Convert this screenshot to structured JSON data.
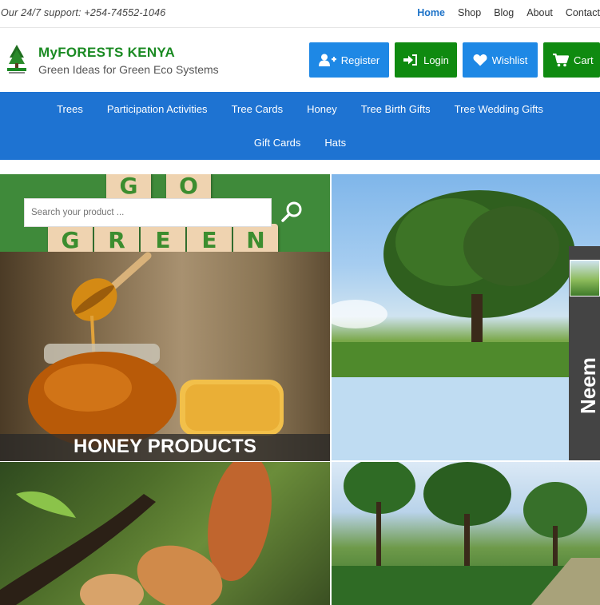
{
  "topbar": {
    "support": "Our 24/7 support: +254-74552-1046",
    "links": [
      {
        "label": "Home",
        "active": true
      },
      {
        "label": "Shop"
      },
      {
        "label": "Blog"
      },
      {
        "label": "About"
      },
      {
        "label": "Contact"
      }
    ]
  },
  "header": {
    "brand": "MyFORESTS KENYA",
    "tagline": "Green Ideas for Green Eco Systems",
    "buttons": {
      "register": "Register",
      "login": "Login",
      "wishlist": "Wishlist",
      "cart": "Cart"
    }
  },
  "nav": {
    "row1": [
      "Trees",
      "Participation Activities",
      "Tree Cards",
      "Honey",
      "Tree Birth Gifts",
      "Tree Wedding Gifts"
    ],
    "row2": [
      "Gift Cards",
      "Hats"
    ]
  },
  "search": {
    "placeholder": "Search your product ..."
  },
  "tiles": {
    "gogreen_letters": [
      "G",
      "O",
      "G",
      "R",
      "E",
      "E",
      "N"
    ],
    "honey": "HONEY PRODUCTS",
    "neem": "Neem"
  },
  "colors": {
    "accent_blue": "#1e73d2",
    "button_blue": "#1e88e5",
    "button_green": "#0f8a10",
    "brand_green": "#1a8a22"
  },
  "icons": {
    "register": "add-user-icon",
    "login": "sign-in-icon",
    "wishlist": "heart-icon",
    "cart": "shopping-cart-icon",
    "search": "search-icon"
  }
}
